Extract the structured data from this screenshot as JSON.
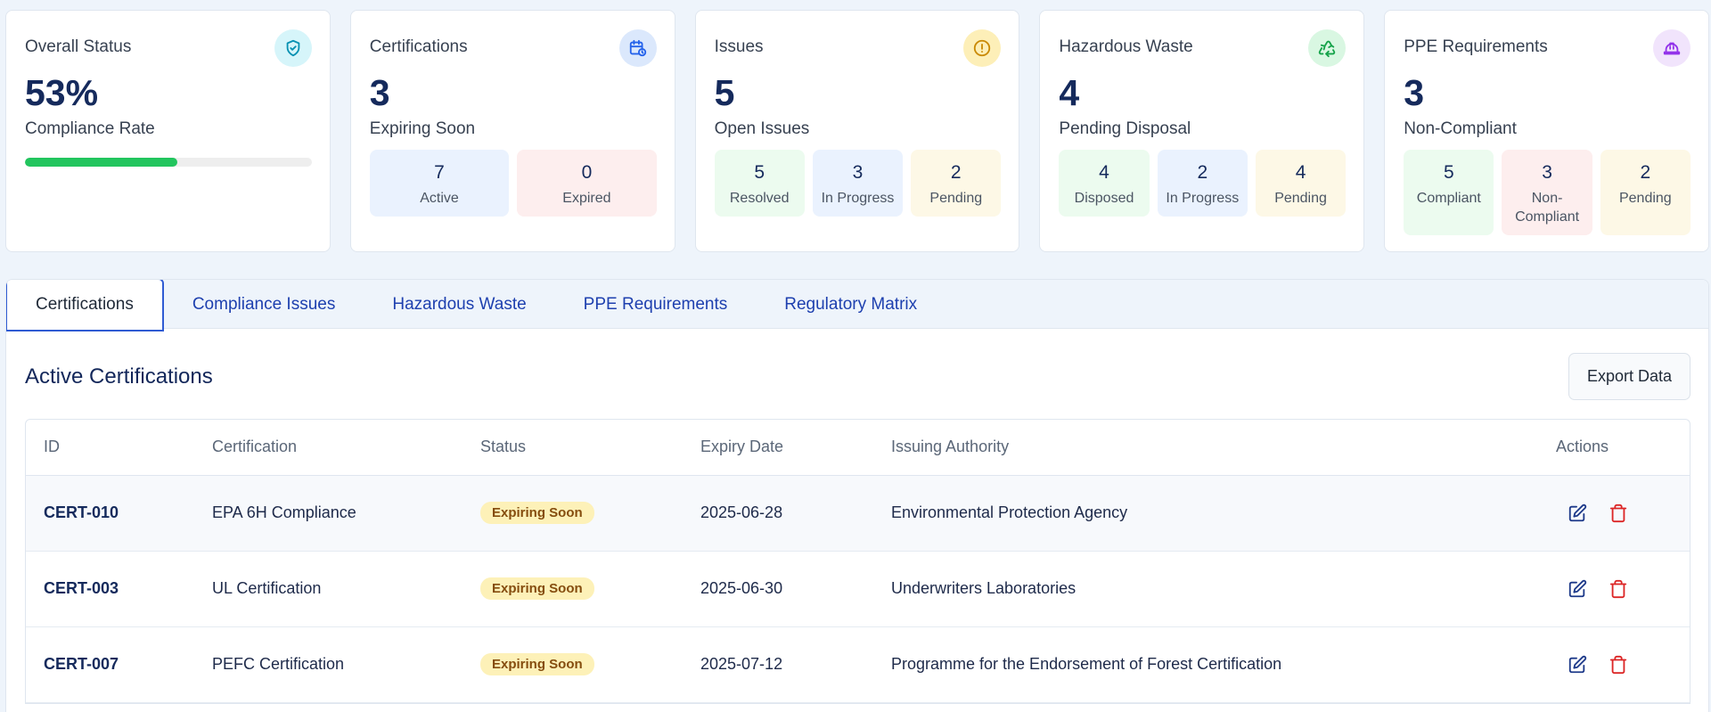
{
  "summary": {
    "overall": {
      "title": "Overall Status",
      "value": "53%",
      "label": "Compliance Rate",
      "progress_percent": 53
    },
    "certifications": {
      "title": "Certifications",
      "value": "3",
      "label": "Expiring Soon",
      "stats": [
        {
          "num": "7",
          "label": "Active"
        },
        {
          "num": "0",
          "label": "Expired"
        }
      ]
    },
    "issues": {
      "title": "Issues",
      "value": "5",
      "label": "Open Issues",
      "stats": [
        {
          "num": "5",
          "label": "Resolved"
        },
        {
          "num": "3",
          "label": "In Progress"
        },
        {
          "num": "2",
          "label": "Pending"
        }
      ]
    },
    "waste": {
      "title": "Hazardous Waste",
      "value": "4",
      "label": "Pending Disposal",
      "stats": [
        {
          "num": "4",
          "label": "Disposed"
        },
        {
          "num": "2",
          "label": "In Progress"
        },
        {
          "num": "4",
          "label": "Pending"
        }
      ]
    },
    "ppe": {
      "title": "PPE Requirements",
      "value": "3",
      "label": "Non-Compliant",
      "stats": [
        {
          "num": "5",
          "label": "Compliant"
        },
        {
          "num": "3",
          "label": "Non-Compliant"
        },
        {
          "num": "2",
          "label": "Pending"
        }
      ]
    }
  },
  "tabs": [
    "Certifications",
    "Compliance Issues",
    "Hazardous Waste",
    "PPE Requirements",
    "Regulatory Matrix"
  ],
  "active_tab": "Certifications",
  "section": {
    "title": "Active Certifications",
    "export_label": "Export Data"
  },
  "table": {
    "headers": {
      "id": "ID",
      "certification": "Certification",
      "status": "Status",
      "expiry": "Expiry Date",
      "authority": "Issuing Authority",
      "actions": "Actions"
    },
    "rows": [
      {
        "id": "CERT-010",
        "certification": "EPA 6H Compliance",
        "status": "Expiring Soon",
        "expiry": "2025-06-28",
        "authority": "Environmental Protection Agency"
      },
      {
        "id": "CERT-003",
        "certification": "UL Certification",
        "status": "Expiring Soon",
        "expiry": "2025-06-30",
        "authority": "Underwriters Laboratories"
      },
      {
        "id": "CERT-007",
        "certification": "PEFC Certification",
        "status": "Expiring Soon",
        "expiry": "2025-07-12",
        "authority": "Programme for the Endorsement of Forest Certification"
      }
    ]
  },
  "colors": {
    "accent": "#2f5bd3",
    "progress": "#22c55e",
    "badge_bg": "#fdf1b8",
    "edit_icon": "#1e3a8a",
    "delete_icon": "#dc2626"
  },
  "icons": {
    "overall": "shield-check-icon",
    "certifications": "calendar-clock-icon",
    "issues": "alert-circle-icon",
    "waste": "recycle-icon",
    "ppe": "hard-hat-icon",
    "edit": "edit-icon",
    "delete": "trash-icon"
  }
}
